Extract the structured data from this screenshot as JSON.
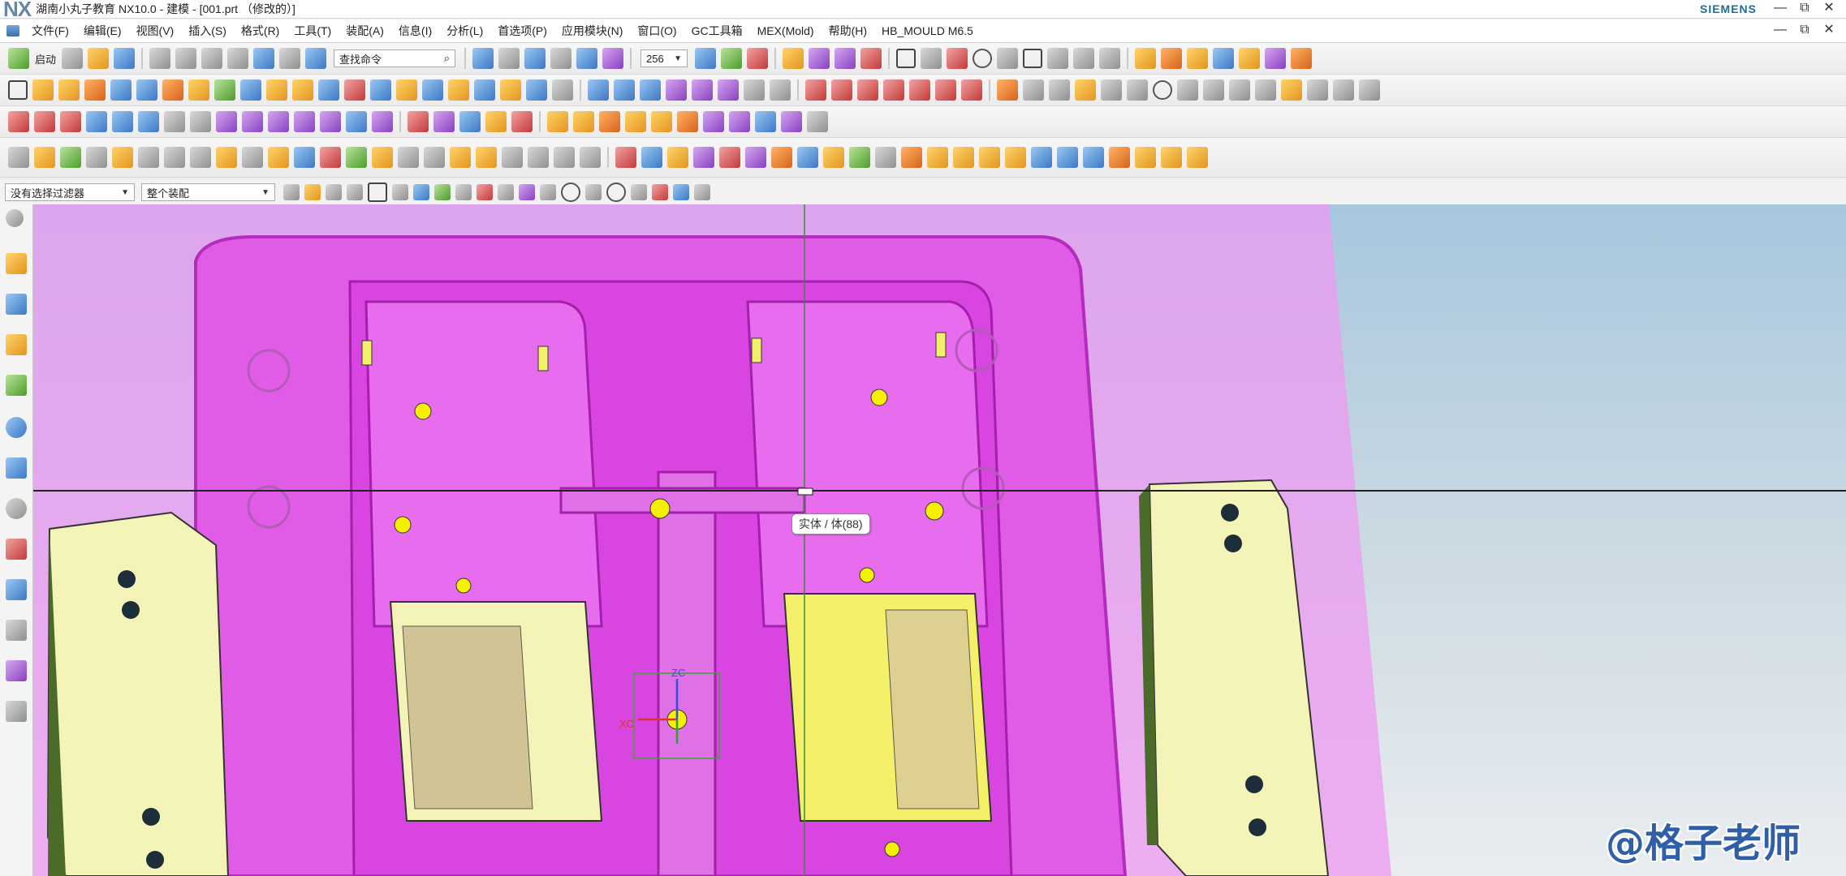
{
  "window": {
    "logo": "NX",
    "title": "湖南小丸子教育 NX10.0 - 建模 - [001.prt （修改的）]",
    "brand": "SIEMENS",
    "controls": [
      "—",
      "⧉",
      "✕"
    ],
    "doc_controls": [
      "—",
      "⧉",
      "✕"
    ]
  },
  "menu": {
    "items": [
      "文件(F)",
      "编辑(E)",
      "视图(V)",
      "插入(S)",
      "格式(R)",
      "工具(T)",
      "装配(A)",
      "信息(I)",
      "分析(L)",
      "首选项(P)",
      "应用模块(N)",
      "窗口(O)",
      "GC工具箱",
      "MEX(Mold)",
      "帮助(H)",
      "HB_MOULD M6.5"
    ]
  },
  "toolbar": {
    "start_label": "启动",
    "search_placeholder": "查找命令",
    "count_value": "256"
  },
  "filter": {
    "selection_filter": "没有选择过滤器",
    "scope": "整个装配"
  },
  "viewport": {
    "tooltip": "实体 / 体(88)",
    "triad": {
      "xc": "XC",
      "zc": "ZC"
    },
    "watermark": "@格子老师",
    "colors": {
      "mold_plate": "#e05be6",
      "plate_rim": "#c524cc",
      "slider_yellow": "#f5f06a",
      "side_block": "#f4f3b8",
      "background_top": "#a7c7de",
      "background_bottom": "#e9edf0"
    }
  },
  "icons": {
    "resource_bar": [
      "gear-icon",
      "assembly-navigator-icon",
      "constraint-navigator-icon",
      "part-navigator-icon",
      "reuse-library-icon",
      "hd3d-icon",
      "web-browser-icon",
      "history-icon",
      "system-materials-icon",
      "process-studio-icon",
      "manufacturing-wizard-icon",
      "roles-icon",
      "palette-icon"
    ]
  }
}
